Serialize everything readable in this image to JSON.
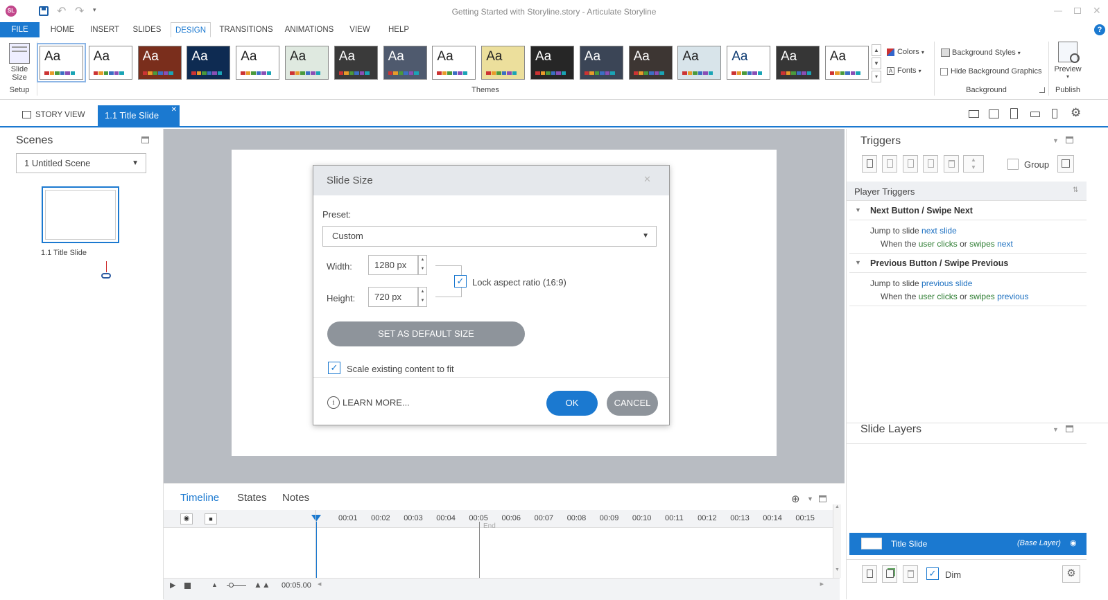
{
  "window": {
    "title": "Getting Started with Storyline.story - Articulate Storyline",
    "app_badge": "SL"
  },
  "ribbon_tabs": [
    "FILE",
    "HOME",
    "INSERT",
    "SLIDES",
    "DESIGN",
    "TRANSITIONS",
    "ANIMATIONS",
    "VIEW",
    "HELP"
  ],
  "ribbon": {
    "slide_size_label_1": "Slide",
    "slide_size_label_2": "Size",
    "setup_label": "Setup",
    "themes_label": "Themes",
    "theme_aa": "Aa",
    "colors_label": "Colors",
    "fonts_label": "Fonts",
    "background_styles_label": "Background Styles",
    "hide_background_label": "Hide Background Graphics",
    "background_group_label": "Background",
    "preview_label": "Preview",
    "publish_label": "Publish",
    "themes": [
      {
        "bg": "#ffffff",
        "fg": "#222222",
        "selected": true
      },
      {
        "bg": "#ffffff",
        "fg": "#222222"
      },
      {
        "bg": "#7a2e1c",
        "fg": "#ffffff"
      },
      {
        "bg": "#0e2b52",
        "fg": "#ffffff"
      },
      {
        "bg": "#ffffff",
        "fg": "#222222"
      },
      {
        "bg": "#dfe9e0",
        "fg": "#222222"
      },
      {
        "bg": "#3a3a3a",
        "fg": "#ffffff"
      },
      {
        "bg": "#4f5a6e",
        "fg": "#ffffff"
      },
      {
        "bg": "#ffffff",
        "fg": "#222222"
      },
      {
        "bg": "#ecdf9c",
        "fg": "#222222"
      },
      {
        "bg": "#262626",
        "fg": "#ffffff"
      },
      {
        "bg": "#3b4556",
        "fg": "#ffffff"
      },
      {
        "bg": "#3d3633",
        "fg": "#ffffff"
      },
      {
        "bg": "#d8e4ea",
        "fg": "#222222"
      },
      {
        "bg": "#ffffff",
        "fg": "#0e3b72"
      },
      {
        "bg": "#363636",
        "fg": "#ffffff"
      },
      {
        "bg": "#ffffff",
        "fg": "#222222"
      }
    ]
  },
  "doc_tabs": {
    "story_view": "STORY VIEW",
    "active": "1.1 Title Slide"
  },
  "scenes": {
    "title": "Scenes",
    "dropdown": "1 Untitled Scene",
    "slide_label": "1.1 Title Slide"
  },
  "dialog": {
    "title": "Slide Size",
    "preset_label": "Preset:",
    "preset_value": "Custom",
    "width_label": "Width:",
    "width_value": "1280 px",
    "height_label": "Height:",
    "height_value": "720 px",
    "lock_label": "Lock aspect ratio (16:9)",
    "lock_checked": true,
    "default_button": "SET AS DEFAULT SIZE",
    "scale_label": "Scale existing content to fit",
    "scale_checked": true,
    "learn_more": "LEARN MORE...",
    "ok": "OK",
    "cancel": "CANCEL"
  },
  "timeline": {
    "tabs": [
      "Timeline",
      "States",
      "Notes"
    ],
    "ticks": [
      "00:01",
      "00:02",
      "00:03",
      "00:04",
      "00:05",
      "00:06",
      "00:07",
      "00:08",
      "00:09",
      "00:10",
      "00:11",
      "00:12",
      "00:13",
      "00:14",
      "00:15"
    ],
    "end_label": "End",
    "time": "00:05.00"
  },
  "triggers": {
    "title": "Triggers",
    "group_label": "Group",
    "player_triggers": "Player Triggers",
    "items": [
      {
        "name": "Next Button / Swipe Next",
        "action_prefix": "Jump to slide ",
        "action_link": "next slide",
        "cond_prefix": "When the ",
        "cond_user": "user",
        "cond_clicks": "clicks",
        "cond_or": " or ",
        "cond_swipes": "swipes",
        "cond_dir": "next"
      },
      {
        "name": "Previous Button / Swipe Previous",
        "action_prefix": "Jump to slide ",
        "action_link": "previous slide",
        "cond_prefix": "When the ",
        "cond_user": "user",
        "cond_clicks": "clicks",
        "cond_or": " or ",
        "cond_swipes": "swipes",
        "cond_dir": "previous"
      }
    ]
  },
  "layers": {
    "title": "Slide Layers",
    "base_name": "Title Slide",
    "base_tag": "(Base Layer)",
    "dim_label": "Dim",
    "dim_checked": true
  },
  "colors": {
    "accent": "#1b79d0",
    "file_tab": "#1b79d0",
    "ok_button": "#1b79d0",
    "gray_button": "#8e949b",
    "link": "#1b6fc0",
    "green": "#2e7d32"
  }
}
